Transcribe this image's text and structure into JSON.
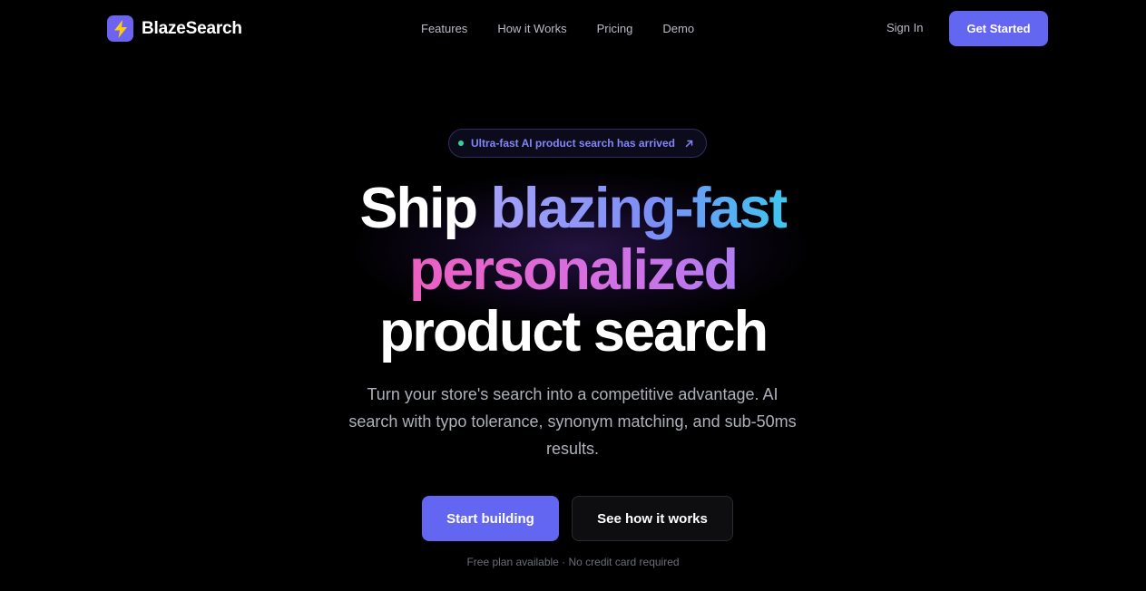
{
  "brand": {
    "name": "BlazeSearch",
    "logo_icon": "lightning-bolt-icon",
    "accent_color": "#6366f1",
    "bolt_color": "#facc15"
  },
  "nav": {
    "links": [
      "Features",
      "How it Works",
      "Pricing",
      "Demo"
    ],
    "sign_in": "Sign In",
    "get_started": "Get Started"
  },
  "hero": {
    "badge": {
      "text": "Ultra-fast AI product search has arrived",
      "dot_color": "#34d399",
      "arrow_icon": "arrow-up-right-icon"
    },
    "headline": {
      "part1": "Ship",
      "part2": "blazing-fast",
      "part3": "personalized",
      "part4": "product search"
    },
    "subtitle": "Turn your store's search into a competitive advantage. AI search with typo tolerance, synonym matching, and sub-50ms results.",
    "primary_cta": "Start building",
    "secondary_cta": "See how it works",
    "footnote": "Free plan available · No credit card required"
  }
}
